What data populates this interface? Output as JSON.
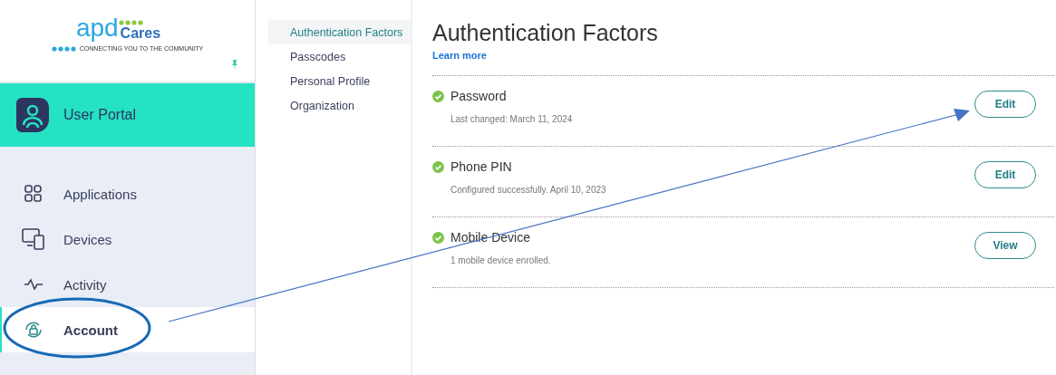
{
  "logo": {
    "word": "apd",
    "word_2": "Cares",
    "tagline": "CONNECTING YOU TO THE COMMUNITY"
  },
  "portal": {
    "title": "User Portal"
  },
  "nav": [
    {
      "kind": "applications",
      "label": "Applications",
      "selected": false
    },
    {
      "kind": "devices",
      "label": "Devices",
      "selected": false
    },
    {
      "kind": "activity",
      "label": "Activity",
      "selected": false
    },
    {
      "kind": "account",
      "label": "Account",
      "selected": true
    }
  ],
  "subnav": [
    {
      "label": "Authentication Factors",
      "selected": true
    },
    {
      "label": "Passcodes",
      "selected": false
    },
    {
      "label": "Personal Profile",
      "selected": false
    },
    {
      "label": "Organization",
      "selected": false
    }
  ],
  "main": {
    "title": "Authentication Factors",
    "link": "Learn more",
    "factors": [
      {
        "name": "Password",
        "detail": "Last changed: March 11, 2024",
        "action": "Edit"
      },
      {
        "name": "Phone PIN",
        "detail": "Configured successfully. April 10, 2023",
        "action": "Edit"
      },
      {
        "name": "Mobile Device",
        "detail": "1 mobile device enrolled.",
        "action": "View"
      }
    ]
  },
  "annotations": {
    "highlight_ellipse": true,
    "arrow": true
  }
}
